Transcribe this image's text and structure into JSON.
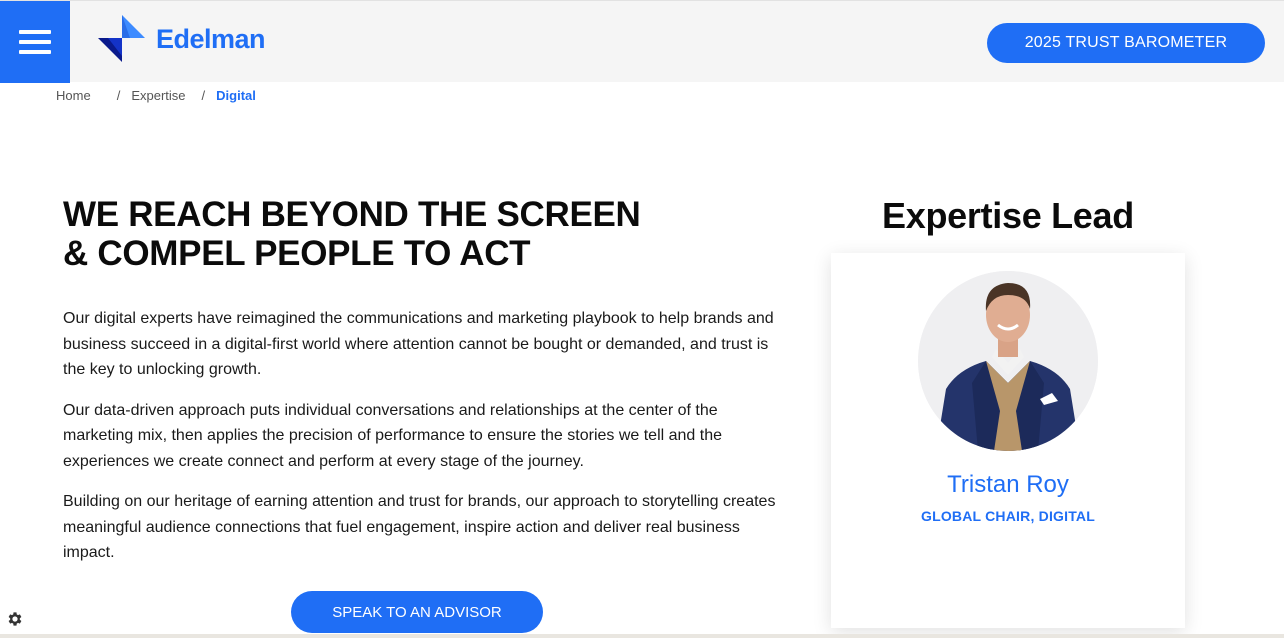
{
  "header": {
    "menu_icon": "hamburger-menu-icon",
    "logo_icon": "edelman-logo-icon",
    "brand_name": "Edelman",
    "cta_label": "2025 TRUST BAROMETER",
    "brand_color": "#1f6ef5"
  },
  "breadcrumb": {
    "items": [
      "Home",
      "Expertise",
      "Digital"
    ],
    "separator": "/"
  },
  "main": {
    "headline_line1": "WE REACH BEYOND THE SCREEN",
    "headline_line2": "& COMPEL PEOPLE TO ACT",
    "paragraphs": [
      "Our digital experts have reimagined the communications and marketing playbook to help brands and business succeed in a digital-first world where attention cannot be bought or demanded, and trust is the key to unlocking growth.",
      "Our data-driven approach puts individual conversations and relationships at the center of the marketing mix, then applies the precision of performance to ensure the stories we tell and the experiences we create connect and perform at every stage of the journey.",
      "Building on our heritage of earning attention and trust for brands, our approach to storytelling creates meaningful audience connections that fuel engagement, inspire action and deliver real business impact."
    ],
    "cta_label": "SPEAK TO AN ADVISOR"
  },
  "lead": {
    "title": "Expertise Lead",
    "name": "Tristan Roy",
    "role": "GLOBAL CHAIR, DIGITAL",
    "photo": "person-portrait"
  },
  "footer": {
    "settings_icon": "gear-icon"
  }
}
